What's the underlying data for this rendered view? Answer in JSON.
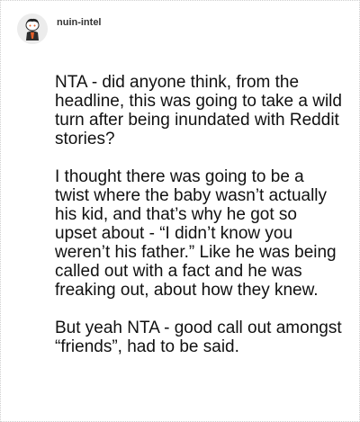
{
  "post": {
    "username": "nuin-intel",
    "avatar_icon": "snoo-avatar-icon",
    "paragraphs": [
      "NTA - did anyone think, from the headline, this was going to take a wild turn after being inundated with Reddit stories?",
      "I thought there was going to be a twist where the baby wasn’t actually his kid, and that’s why he got so upset about - “I didn’t know you weren’t his father.” Like he was being called out with a fact and he was freaking out, about how they knew.",
      "But yeah NTA - good call out amongst “friends”, had to be said."
    ]
  }
}
